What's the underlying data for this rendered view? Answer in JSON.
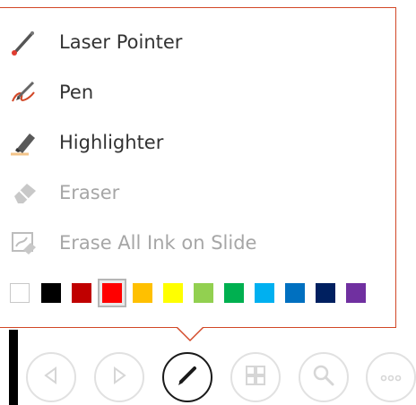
{
  "menu": {
    "items": [
      {
        "label": "Laser Pointer",
        "icon": "laser-pointer-icon",
        "enabled": true
      },
      {
        "label": "Pen",
        "icon": "pen-icon",
        "enabled": true
      },
      {
        "label": "Highlighter",
        "icon": "highlighter-icon",
        "enabled": true
      },
      {
        "label": "Eraser",
        "icon": "eraser-icon",
        "enabled": false
      },
      {
        "label": "Erase All Ink on Slide",
        "icon": "erase-all-ink-icon",
        "enabled": false
      }
    ],
    "border_color": "#d24726"
  },
  "palette": {
    "selected_index": 3,
    "colors": [
      "#ffffff",
      "#000000",
      "#c00000",
      "#ff0000",
      "#ffc000",
      "#ffff00",
      "#92d050",
      "#00b050",
      "#00b0f0",
      "#0070c0",
      "#002060",
      "#7030a0"
    ]
  },
  "toolbar": {
    "buttons": [
      {
        "name": "previous-button",
        "icon": "triangle-left-icon",
        "active": false
      },
      {
        "name": "next-button",
        "icon": "triangle-right-icon",
        "active": false
      },
      {
        "name": "pen-tools-button",
        "icon": "pen-icon",
        "active": true
      },
      {
        "name": "see-all-slides-button",
        "icon": "slides-grid-icon",
        "active": false
      },
      {
        "name": "zoom-button",
        "icon": "magnifier-icon",
        "active": false
      },
      {
        "name": "more-options-button",
        "icon": "ellipsis-icon",
        "active": false
      }
    ]
  }
}
